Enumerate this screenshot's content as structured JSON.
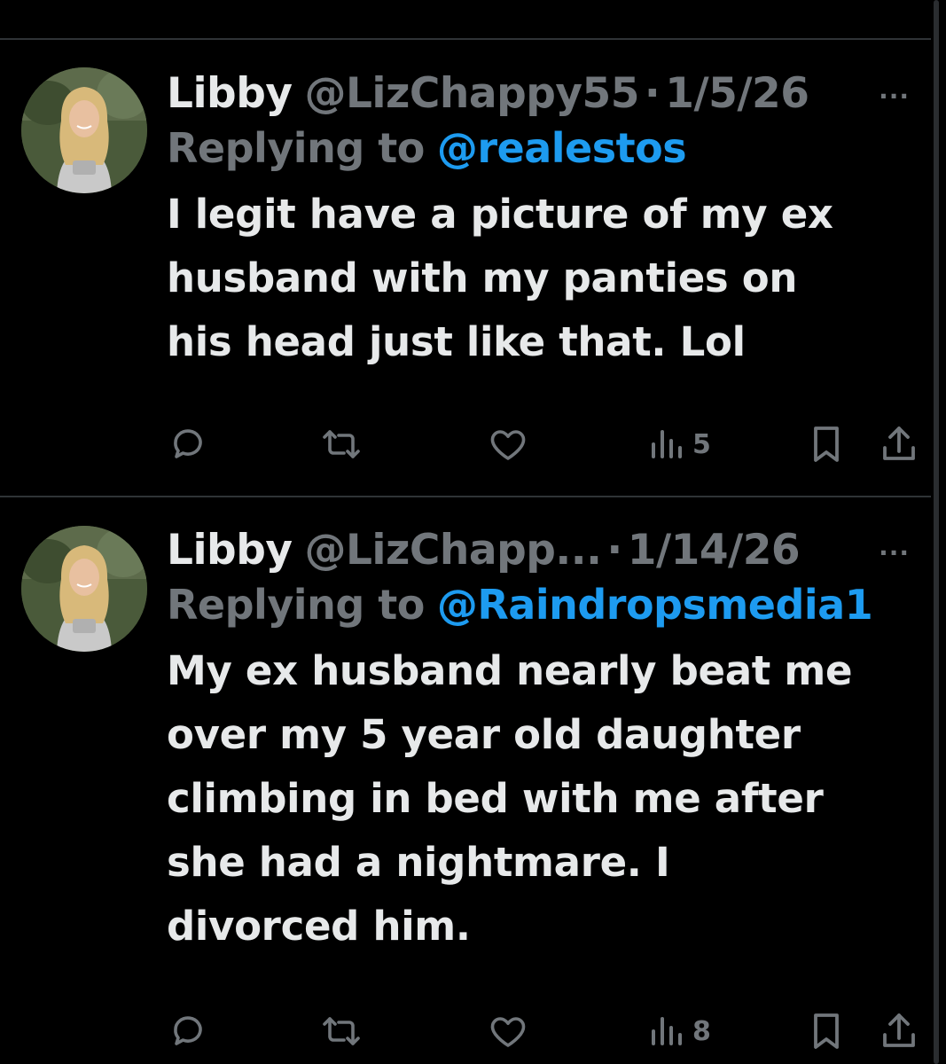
{
  "tweets": [
    {
      "name": "Libby",
      "handle": "@LizChappy55",
      "separator": "·",
      "date": "1/5/26",
      "more": "···",
      "reply_label": "Replying to",
      "reply_to": "@realestos",
      "text_lines": [
        "I legit have a picture of my ex",
        "husband with my panties on",
        "his head just like that. Lol"
      ],
      "views": "5"
    },
    {
      "name": "Libby",
      "handle": "@LizChapp...",
      "separator": "·",
      "date": "1/14/26",
      "more": "···",
      "reply_label": "Replying to",
      "reply_to": "@Raindropsmedia1",
      "text_lines": [
        "My ex husband nearly beat me",
        "over my 5 year old daughter",
        "climbing in bed with me after",
        "she had a nightmare. I",
        "divorced him."
      ],
      "views": "8"
    }
  ],
  "icons": {
    "reply": "reply-icon",
    "retweet": "retweet-icon",
    "like": "heart-icon",
    "views": "views-bar-icon",
    "bookmark": "bookmark-icon",
    "share": "share-icon"
  },
  "colors": {
    "background": "#000000",
    "text": "#e7e9ea",
    "muted": "#71767b",
    "link": "#1d9bf0",
    "divider": "#2f3336"
  }
}
